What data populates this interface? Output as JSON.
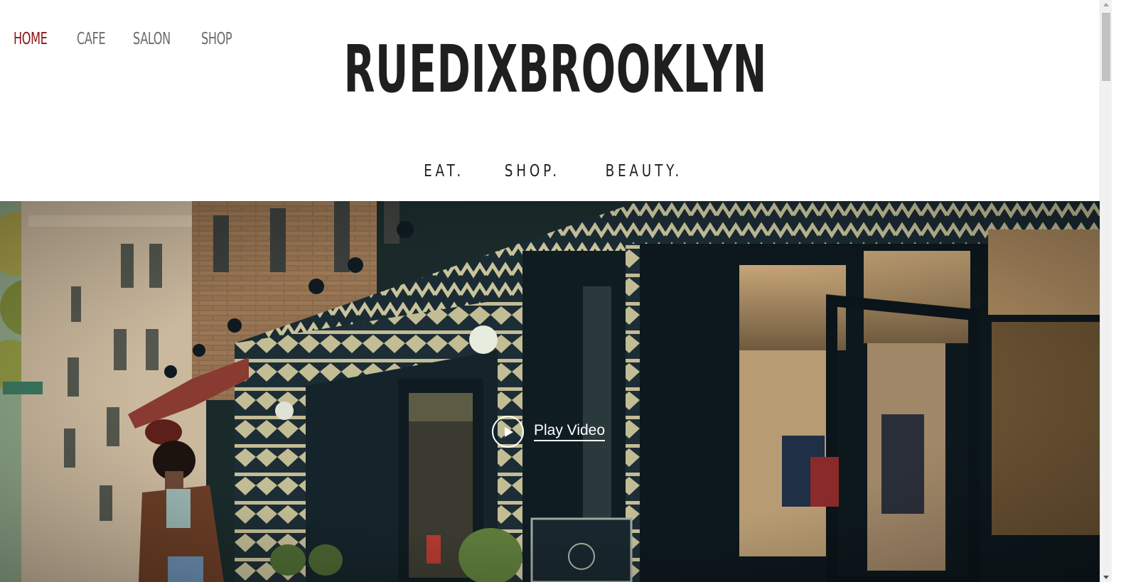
{
  "nav": {
    "items": [
      {
        "label": "HOME",
        "active": true
      },
      {
        "label": "CAFE",
        "active": false
      },
      {
        "label": "SALON",
        "active": false
      },
      {
        "label": "SHOP",
        "active": false
      }
    ]
  },
  "brand": {
    "name": "RUEDIXBROOKLYN"
  },
  "tagline": {
    "items": [
      "EAT.",
      "SHOP.",
      "BEAUTY."
    ]
  },
  "hero": {
    "play_label": "Play Video"
  },
  "colors": {
    "accent": "#8b1414",
    "nav_text": "#6b6b6b",
    "title": "#1f1f1f"
  },
  "icons": {
    "play": "play-icon"
  }
}
